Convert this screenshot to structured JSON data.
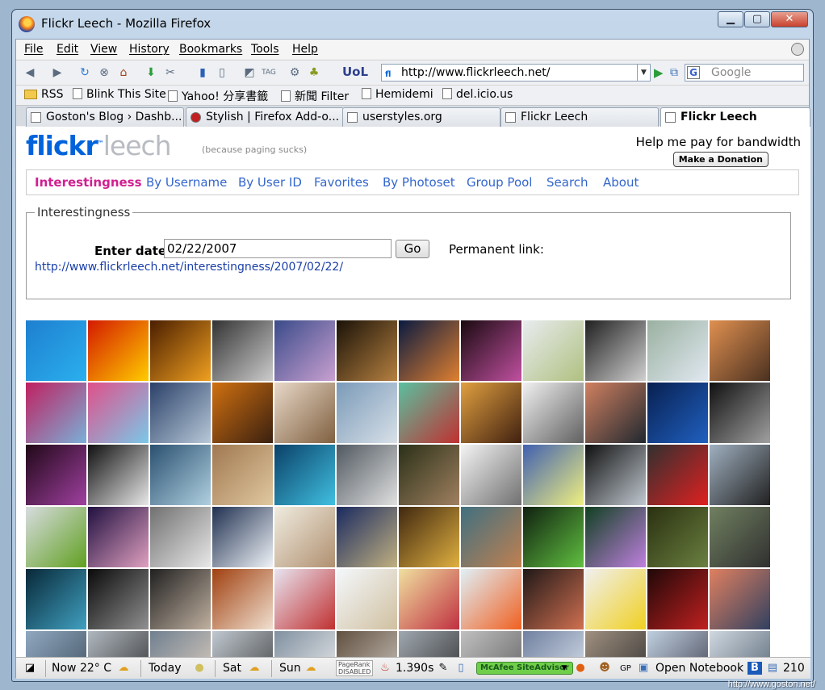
{
  "window": {
    "title": "Flickr Leech - Mozilla Firefox"
  },
  "menu": [
    "File",
    "Edit",
    "View",
    "History",
    "Bookmarks",
    "Tools",
    "Help"
  ],
  "navbar": {
    "url": "http://www.flickrleech.net/",
    "search_placeholder": "Google",
    "uol_label": "UoL"
  },
  "bookmarks": [
    "RSS",
    "Blink This Site",
    "Yahoo! 分享書籤",
    "新聞 Filter",
    "Hemidemi",
    "del.icio.us"
  ],
  "tabs": [
    "Goston's Blog › Dashb...",
    "Stylish | Firefox Add-o...",
    "userstyles.org",
    "Flickr Leech",
    "Flickr Leech"
  ],
  "site": {
    "logo_main": "flickr",
    "logo_tm": "™",
    "logo_leech": "leech",
    "tagline": "(because paging sucks)",
    "bandwidth": "Help me pay for bandwidth",
    "donate": "Make a Donation",
    "nav": [
      "Interestingness",
      "By Username",
      "By User ID",
      "Favorites",
      "By Photoset",
      "Group Pool",
      "Search",
      "About"
    ],
    "section_title": "Interestingness",
    "date_label": "Enter date",
    "date_value": "02/22/2007",
    "go_button": "Go",
    "permanent_link_label": "Permanent link:",
    "permanent_link_url": "http://www.flickrleech.net/interestingness/2007/02/22/"
  },
  "thumbs": [
    [
      "#1e7fd0",
      "#2bb0ee"
    ],
    [
      "#d31a00",
      "#ffcc00"
    ],
    [
      "#4a1e00",
      "#f0a020"
    ],
    [
      "#333333",
      "#cccccc"
    ],
    [
      "#3a4b8a",
      "#c9a0d0"
    ],
    [
      "#1a1208",
      "#b58040"
    ],
    [
      "#0a1a40",
      "#e08030"
    ],
    [
      "#1a0a10",
      "#c050a0"
    ],
    [
      "#e8ecef",
      "#b0c080"
    ],
    [
      "#202020",
      "#d0d0d0"
    ],
    [
      "#9ab0a0",
      "#e0e8f0"
    ],
    [
      "#e09050",
      "#4a3020"
    ],
    [
      "#c02060",
      "#7ab0d8"
    ],
    [
      "#e0508a",
      "#7ac8e8"
    ],
    [
      "#2a4068",
      "#b8c8d8"
    ],
    [
      "#d07010",
      "#3a2010"
    ],
    [
      "#e8d8c8",
      "#806040"
    ],
    [
      "#7a9ab8",
      "#d8e0e8"
    ],
    [
      "#5ac0a0",
      "#c03030"
    ],
    [
      "#e0a040",
      "#402010"
    ],
    [
      "#f0f0f0",
      "#606060"
    ],
    [
      "#d08060",
      "#202830"
    ],
    [
      "#082050",
      "#2060c0"
    ],
    [
      "#101010",
      "#a0a0a0"
    ],
    [
      "#200818",
      "#a040a0"
    ],
    [
      "#101010",
      "#e8e8e8"
    ],
    [
      "#2a5070",
      "#b0d0e0"
    ],
    [
      "#a07850",
      "#e0c8a0"
    ],
    [
      "#0a4068",
      "#40c0e0"
    ],
    [
      "#505860",
      "#e0e0e0"
    ],
    [
      "#2a3018",
      "#a08060"
    ],
    [
      "#f4f4f4",
      "#707070"
    ],
    [
      "#4060b0",
      "#f0f080"
    ],
    [
      "#101010",
      "#c0c8d0"
    ],
    [
      "#303030",
      "#e02020"
    ],
    [
      "#a0b0c0",
      "#202020"
    ],
    [
      "#d8dce0",
      "#60a020"
    ],
    [
      "#201040",
      "#e0a0c0"
    ],
    [
      "#707070",
      "#e8e8e8"
    ],
    [
      "#203050",
      "#f0f4f8"
    ],
    [
      "#f0ece0",
      "#b09070"
    ],
    [
      "#1a2a60",
      "#c0b080"
    ],
    [
      "#402810",
      "#e0b040"
    ],
    [
      "#407080",
      "#c08050"
    ],
    [
      "#102010",
      "#60c040"
    ],
    [
      "#104020",
      "#c080e0"
    ],
    [
      "#2a3010",
      "#6a8040"
    ],
    [
      "#708060",
      "#303030"
    ],
    [
      "#082838",
      "#40a0c0"
    ],
    [
      "#0a0a0a",
      "#909090"
    ],
    [
      "#202020",
      "#c0b0a0"
    ],
    [
      "#a04010",
      "#f0e0d0"
    ],
    [
      "#e8e4f0",
      "#c03030"
    ],
    [
      "#f4f8fc",
      "#d0c0a0"
    ],
    [
      "#f0e0a0",
      "#c03040"
    ],
    [
      "#e0f0f8",
      "#f06020"
    ],
    [
      "#201818",
      "#d07050"
    ],
    [
      "#f0f0f0",
      "#f0d020"
    ],
    [
      "#200808",
      "#c02020"
    ],
    [
      "#e08060",
      "#304060"
    ],
    [
      "#90a8c0",
      "#405060"
    ],
    [
      "#b0b8c0",
      "#303030"
    ],
    [
      "#708090",
      "#e0d0c0"
    ],
    [
      "#c0c8d0",
      "#404040"
    ],
    [
      "#8090a0",
      "#f0f0f0"
    ],
    [
      "#605040",
      "#d0c8c0"
    ],
    [
      "#a0a8b0",
      "#303030"
    ],
    [
      "#c0c0c0",
      "#606060"
    ],
    [
      "#7080a0",
      "#e0e8f0"
    ],
    [
      "#a09080",
      "#303030"
    ],
    [
      "#c0d0e0",
      "#404050"
    ],
    [
      "#d0d8e0",
      "#506070"
    ]
  ],
  "statusbar": {
    "weather_now": "Now 22° C",
    "today": "Today",
    "sat": "Sat",
    "sun": "Sun",
    "pagerank": [
      "PageRank",
      "DISABLED"
    ],
    "timer": "1.390s",
    "mcafee": "McAfee SiteAdvisor",
    "gp": "GP",
    "notebook": "Open Notebook",
    "count": "210"
  },
  "watermark": "http://www.goston.net/"
}
